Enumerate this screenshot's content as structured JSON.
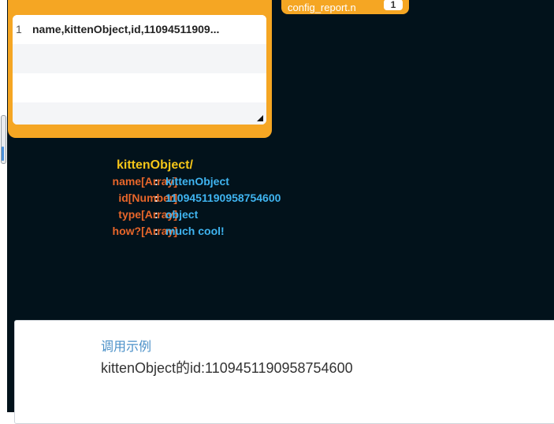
{
  "node": {
    "line_number": "1",
    "line_text": "name,kittenObject,id,11094511909..."
  },
  "tab": {
    "label": "config_report.n",
    "badge": "1"
  },
  "object": {
    "title": "kittenObject/",
    "fields": [
      {
        "key": "name[Array]",
        "value": "kittenObject"
      },
      {
        "key": "id[Number]",
        "value": "1109451190958754600"
      },
      {
        "key": "type[Array]",
        "value": "object"
      },
      {
        "key": "how?[Array]",
        "value": "much cool!"
      }
    ],
    "colon": ":"
  },
  "example": {
    "title": "调用示例",
    "text": "kittenObject的id:1109451190958754600"
  },
  "colors": {
    "accent": "#f5a623",
    "background": "#02121b",
    "key": "#e8662a",
    "value": "#3fb4f0",
    "title": "#f5c518"
  }
}
